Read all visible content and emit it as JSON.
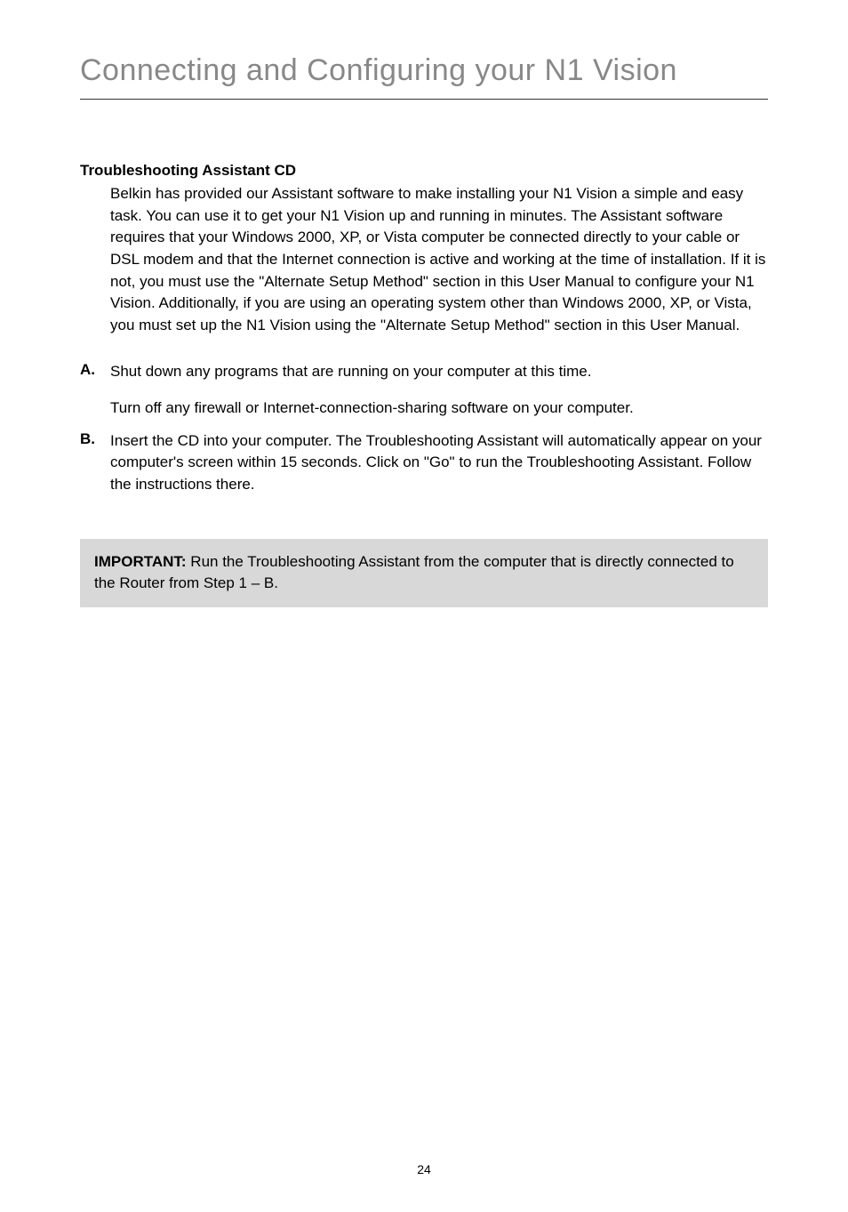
{
  "title": "Connecting and Configuring your N1 Vision",
  "section_heading": "Troubleshooting Assistant CD",
  "intro": "Belkin has provided our Assistant software to make installing your N1 Vision a simple and easy task. You can use it to get your N1 Vision up and running in minutes. The Assistant software requires that your Windows 2000, XP, or Vista computer be connected directly to your cable or DSL modem and that the Internet connection is active and working at the time of installation. If it is not, you must use the \"Alternate Setup Method\" section in this User Manual to configure your N1 Vision. Additionally, if you are using an operating system other than Windows 2000, XP, or Vista, you must set up the N1 Vision using the \"Alternate Setup Method\" section in this User Manual.",
  "items": [
    {
      "marker": "A.",
      "paragraphs": [
        "Shut down any programs that are running on your computer at this time.",
        "Turn off any firewall or Internet-connection-sharing software on your computer."
      ]
    },
    {
      "marker": "B.",
      "paragraphs": [
        "Insert the CD into your computer. The Troubleshooting Assistant will automatically appear on your computer's screen within 15 seconds. Click on \"Go\" to run the Troubleshooting Assistant. Follow the instructions there."
      ]
    }
  ],
  "important": {
    "label": "IMPORTANT:",
    "text": " Run the Troubleshooting Assistant from the computer that is directly connected to the Router from Step 1 – B."
  },
  "page_number": "24"
}
